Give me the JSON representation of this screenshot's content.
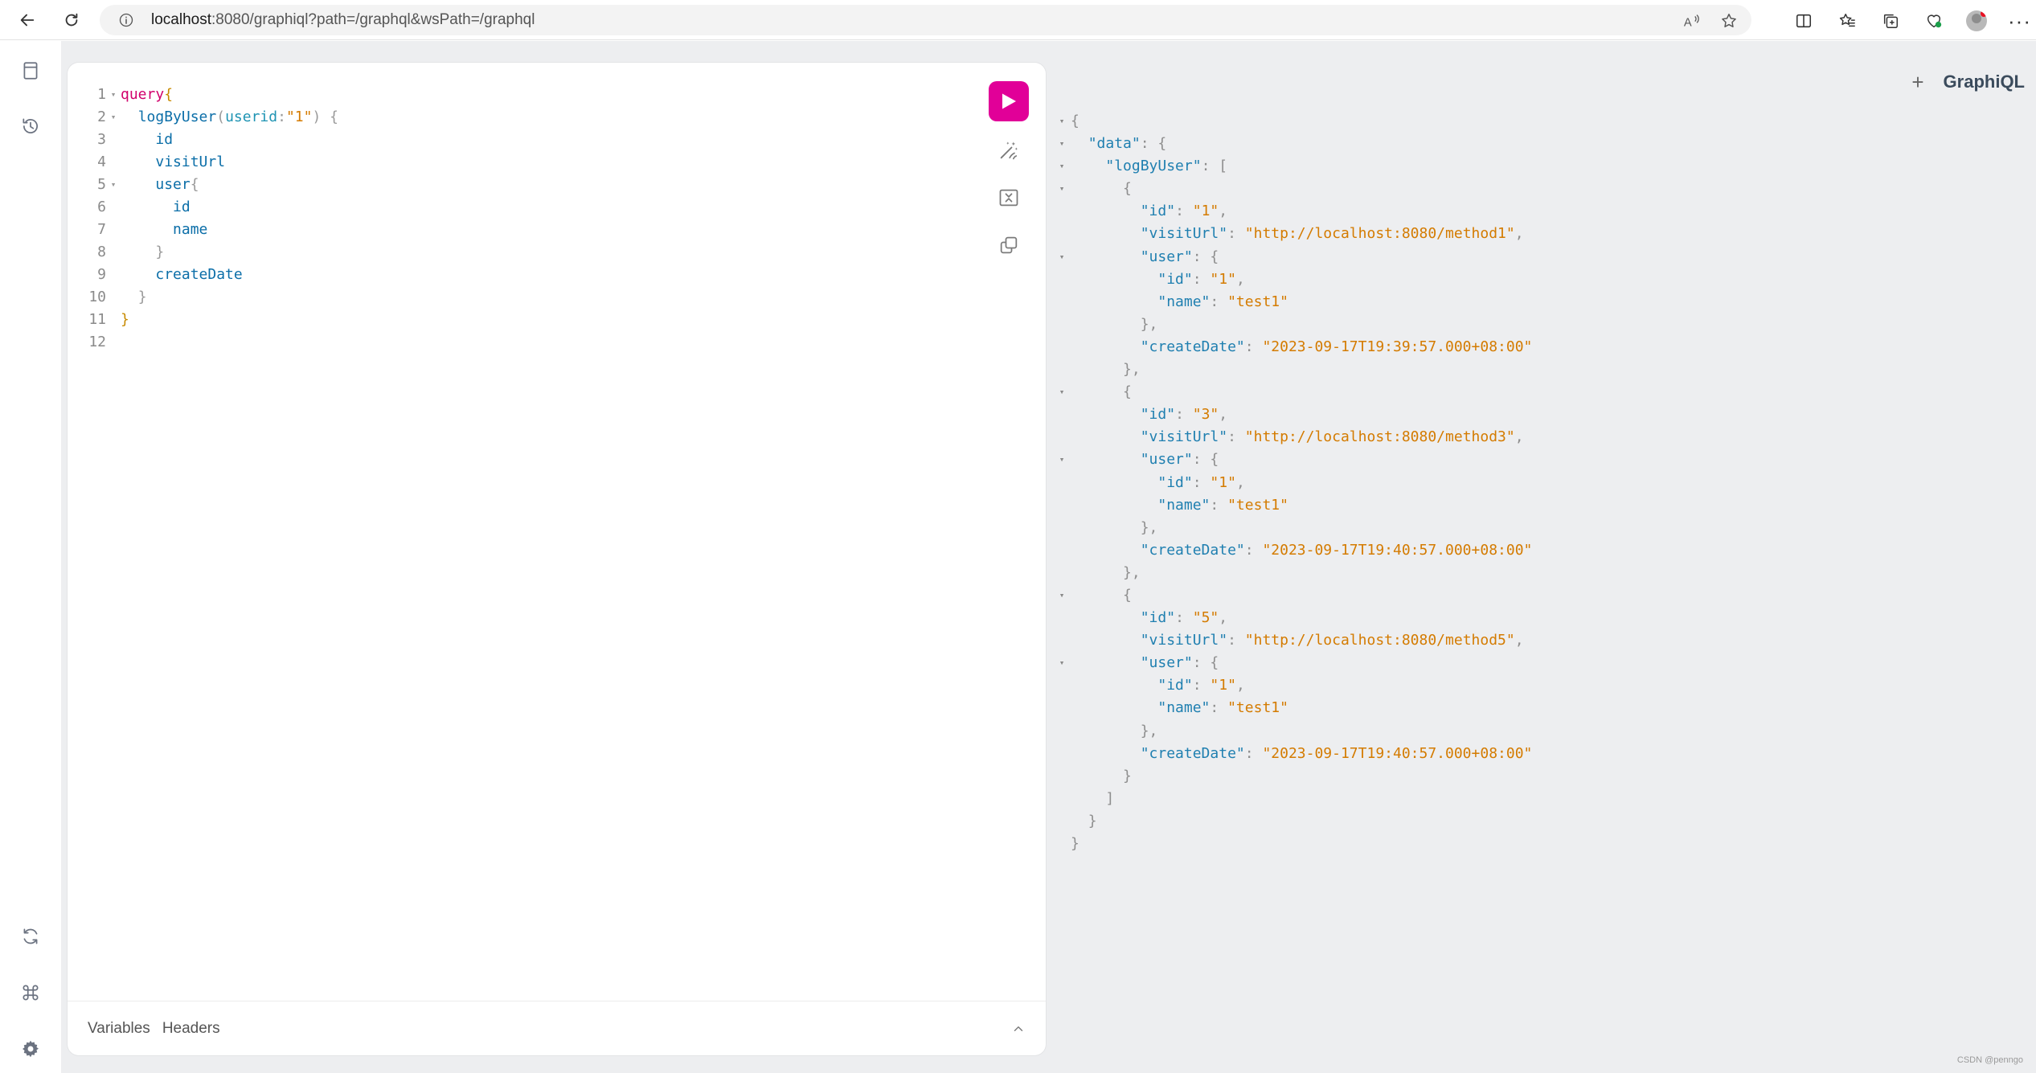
{
  "browser": {
    "url_host": "localhost",
    "url_rest": ":8080/graphiql?path=/graphql&wsPath=/graphql"
  },
  "editor": {
    "lines": [
      {
        "num": "1",
        "fold": "▾",
        "tokens": [
          [
            "kw",
            "query"
          ],
          [
            "brace",
            "{"
          ]
        ]
      },
      {
        "num": "2",
        "fold": "▾",
        "tokens": [
          [
            "sp",
            "  "
          ],
          [
            "field",
            "logByUser"
          ],
          [
            "punc",
            "("
          ],
          [
            "arg",
            "userid"
          ],
          [
            "punc",
            ":"
          ],
          [
            "str",
            "\"1\""
          ],
          [
            "punc",
            ") {"
          ]
        ]
      },
      {
        "num": "3",
        "fold": "",
        "tokens": [
          [
            "sp",
            "    "
          ],
          [
            "field",
            "id"
          ]
        ]
      },
      {
        "num": "4",
        "fold": "",
        "tokens": [
          [
            "sp",
            "    "
          ],
          [
            "field",
            "visitUrl"
          ]
        ]
      },
      {
        "num": "5",
        "fold": "▾",
        "tokens": [
          [
            "sp",
            "    "
          ],
          [
            "field",
            "user"
          ],
          [
            "punc",
            "{"
          ]
        ]
      },
      {
        "num": "6",
        "fold": "",
        "tokens": [
          [
            "sp",
            "      "
          ],
          [
            "field",
            "id"
          ]
        ]
      },
      {
        "num": "7",
        "fold": "",
        "tokens": [
          [
            "sp",
            "      "
          ],
          [
            "field",
            "name"
          ]
        ]
      },
      {
        "num": "8",
        "fold": "",
        "tokens": [
          [
            "sp",
            "    "
          ],
          [
            "punc",
            "}"
          ]
        ]
      },
      {
        "num": "9",
        "fold": "",
        "tokens": [
          [
            "sp",
            "    "
          ],
          [
            "field",
            "createDate"
          ]
        ]
      },
      {
        "num": "10",
        "fold": "",
        "tokens": [
          [
            "sp",
            "  "
          ],
          [
            "punc",
            "}"
          ]
        ]
      },
      {
        "num": "11",
        "fold": "",
        "tokens": [
          [
            "brace",
            "}"
          ]
        ]
      },
      {
        "num": "12",
        "fold": "",
        "tokens": []
      }
    ],
    "footer": {
      "variables_tab": "Variables",
      "headers_tab": "Headers"
    }
  },
  "result": {
    "brand": "GraphiQL",
    "plus": "+",
    "lines": [
      {
        "fold": "▾",
        "tokens": [
          [
            "punc",
            "{"
          ]
        ]
      },
      {
        "fold": "▾",
        "tokens": [
          [
            "sp",
            "  "
          ],
          [
            "key",
            "\"data\""
          ],
          [
            "punc",
            ": {"
          ]
        ]
      },
      {
        "fold": "▾",
        "tokens": [
          [
            "sp",
            "    "
          ],
          [
            "key",
            "\"logByUser\""
          ],
          [
            "punc",
            ": ["
          ]
        ]
      },
      {
        "fold": "▾",
        "tokens": [
          [
            "sp",
            "      "
          ],
          [
            "punc",
            "{"
          ]
        ]
      },
      {
        "fold": "",
        "tokens": [
          [
            "sp",
            "        "
          ],
          [
            "key",
            "\"id\""
          ],
          [
            "punc",
            ": "
          ],
          [
            "str",
            "\"1\""
          ],
          [
            "punc",
            ","
          ]
        ]
      },
      {
        "fold": "",
        "tokens": [
          [
            "sp",
            "        "
          ],
          [
            "key",
            "\"visitUrl\""
          ],
          [
            "punc",
            ": "
          ],
          [
            "str",
            "\"http://localhost:8080/method1\""
          ],
          [
            "punc",
            ","
          ]
        ]
      },
      {
        "fold": "▾",
        "tokens": [
          [
            "sp",
            "        "
          ],
          [
            "key",
            "\"user\""
          ],
          [
            "punc",
            ": {"
          ]
        ]
      },
      {
        "fold": "",
        "tokens": [
          [
            "sp",
            "          "
          ],
          [
            "key",
            "\"id\""
          ],
          [
            "punc",
            ": "
          ],
          [
            "str",
            "\"1\""
          ],
          [
            "punc",
            ","
          ]
        ]
      },
      {
        "fold": "",
        "tokens": [
          [
            "sp",
            "          "
          ],
          [
            "key",
            "\"name\""
          ],
          [
            "punc",
            ": "
          ],
          [
            "str",
            "\"test1\""
          ]
        ]
      },
      {
        "fold": "",
        "tokens": [
          [
            "sp",
            "        "
          ],
          [
            "punc",
            "},"
          ]
        ]
      },
      {
        "fold": "",
        "tokens": [
          [
            "sp",
            "        "
          ],
          [
            "key",
            "\"createDate\""
          ],
          [
            "punc",
            ": "
          ],
          [
            "str",
            "\"2023-09-17T19:39:57.000+08:00\""
          ]
        ]
      },
      {
        "fold": "",
        "tokens": [
          [
            "sp",
            "      "
          ],
          [
            "punc",
            "},"
          ]
        ]
      },
      {
        "fold": "▾",
        "tokens": [
          [
            "sp",
            "      "
          ],
          [
            "punc",
            "{"
          ]
        ]
      },
      {
        "fold": "",
        "tokens": [
          [
            "sp",
            "        "
          ],
          [
            "key",
            "\"id\""
          ],
          [
            "punc",
            ": "
          ],
          [
            "str",
            "\"3\""
          ],
          [
            "punc",
            ","
          ]
        ]
      },
      {
        "fold": "",
        "tokens": [
          [
            "sp",
            "        "
          ],
          [
            "key",
            "\"visitUrl\""
          ],
          [
            "punc",
            ": "
          ],
          [
            "str",
            "\"http://localhost:8080/method3\""
          ],
          [
            "punc",
            ","
          ]
        ]
      },
      {
        "fold": "▾",
        "tokens": [
          [
            "sp",
            "        "
          ],
          [
            "key",
            "\"user\""
          ],
          [
            "punc",
            ": {"
          ]
        ]
      },
      {
        "fold": "",
        "tokens": [
          [
            "sp",
            "          "
          ],
          [
            "key",
            "\"id\""
          ],
          [
            "punc",
            ": "
          ],
          [
            "str",
            "\"1\""
          ],
          [
            "punc",
            ","
          ]
        ]
      },
      {
        "fold": "",
        "tokens": [
          [
            "sp",
            "          "
          ],
          [
            "key",
            "\"name\""
          ],
          [
            "punc",
            ": "
          ],
          [
            "str",
            "\"test1\""
          ]
        ]
      },
      {
        "fold": "",
        "tokens": [
          [
            "sp",
            "        "
          ],
          [
            "punc",
            "},"
          ]
        ]
      },
      {
        "fold": "",
        "tokens": [
          [
            "sp",
            "        "
          ],
          [
            "key",
            "\"createDate\""
          ],
          [
            "punc",
            ": "
          ],
          [
            "str",
            "\"2023-09-17T19:40:57.000+08:00\""
          ]
        ]
      },
      {
        "fold": "",
        "tokens": [
          [
            "sp",
            "      "
          ],
          [
            "punc",
            "},"
          ]
        ]
      },
      {
        "fold": "▾",
        "tokens": [
          [
            "sp",
            "      "
          ],
          [
            "punc",
            "{"
          ]
        ]
      },
      {
        "fold": "",
        "tokens": [
          [
            "sp",
            "        "
          ],
          [
            "key",
            "\"id\""
          ],
          [
            "punc",
            ": "
          ],
          [
            "str",
            "\"5\""
          ],
          [
            "punc",
            ","
          ]
        ]
      },
      {
        "fold": "",
        "tokens": [
          [
            "sp",
            "        "
          ],
          [
            "key",
            "\"visitUrl\""
          ],
          [
            "punc",
            ": "
          ],
          [
            "str",
            "\"http://localhost:8080/method5\""
          ],
          [
            "punc",
            ","
          ]
        ]
      },
      {
        "fold": "▾",
        "tokens": [
          [
            "sp",
            "        "
          ],
          [
            "key",
            "\"user\""
          ],
          [
            "punc",
            ": {"
          ]
        ]
      },
      {
        "fold": "",
        "tokens": [
          [
            "sp",
            "          "
          ],
          [
            "key",
            "\"id\""
          ],
          [
            "punc",
            ": "
          ],
          [
            "str",
            "\"1\""
          ],
          [
            "punc",
            ","
          ]
        ]
      },
      {
        "fold": "",
        "tokens": [
          [
            "sp",
            "          "
          ],
          [
            "key",
            "\"name\""
          ],
          [
            "punc",
            ": "
          ],
          [
            "str",
            "\"test1\""
          ]
        ]
      },
      {
        "fold": "",
        "tokens": [
          [
            "sp",
            "        "
          ],
          [
            "punc",
            "},"
          ]
        ]
      },
      {
        "fold": "",
        "tokens": [
          [
            "sp",
            "        "
          ],
          [
            "key",
            "\"createDate\""
          ],
          [
            "punc",
            ": "
          ],
          [
            "str",
            "\"2023-09-17T19:40:57.000+08:00\""
          ]
        ]
      },
      {
        "fold": "",
        "tokens": [
          [
            "sp",
            "      "
          ],
          [
            "punc",
            "}"
          ]
        ]
      },
      {
        "fold": "",
        "tokens": [
          [
            "sp",
            "    "
          ],
          [
            "punc",
            "]"
          ]
        ]
      },
      {
        "fold": "",
        "tokens": [
          [
            "sp",
            "  "
          ],
          [
            "punc",
            "}"
          ]
        ]
      },
      {
        "fold": "",
        "tokens": [
          [
            "punc",
            "}"
          ]
        ]
      }
    ]
  },
  "watermark": "CSDN @penngo",
  "colors": {
    "accent": "#e10098",
    "keyword": "#d1006c",
    "field": "#0b6ea8",
    "string": "#d47b00"
  }
}
